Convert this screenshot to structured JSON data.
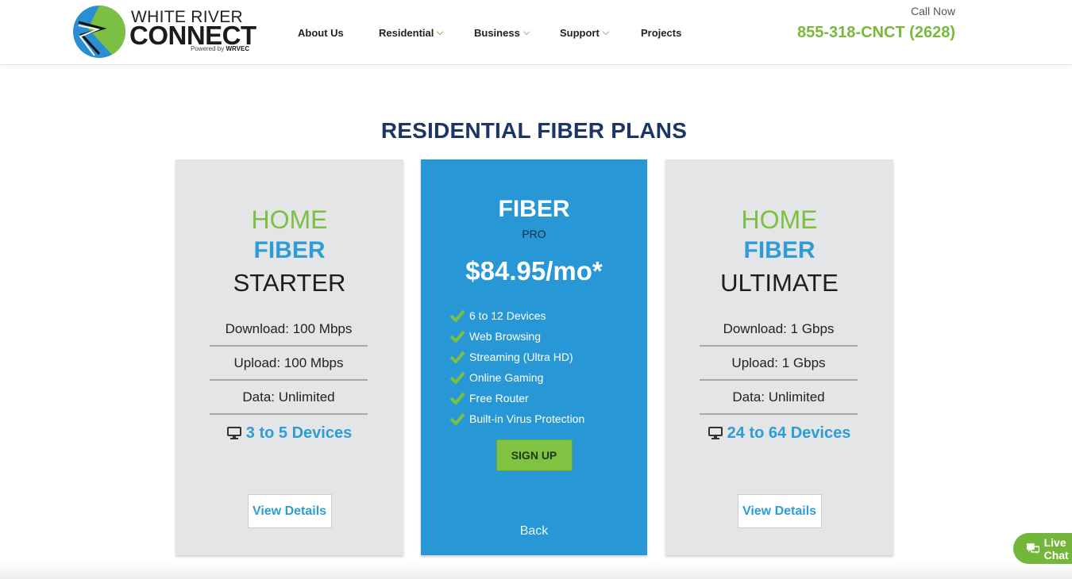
{
  "header": {
    "logo": {
      "top_text": "WHITE RIVER",
      "main_text": "CONNECT",
      "powered_by": "Powered by",
      "powered_brand": "WRVEC"
    },
    "nav": [
      {
        "label": "About Us",
        "dropdown": false
      },
      {
        "label": "Residential",
        "dropdown": true,
        "active": true
      },
      {
        "label": "Business",
        "dropdown": true
      },
      {
        "label": "Support",
        "dropdown": true
      },
      {
        "label": "Projects",
        "dropdown": false
      }
    ],
    "call_label": "Call Now",
    "phone": "855-318-CNCT (2628)"
  },
  "section_title": "RESIDENTIAL FIBER PLANS",
  "plans": [
    {
      "line1": "HOME",
      "line2": "FIBER",
      "line3": "STARTER",
      "download": "Download: 100 Mbps",
      "upload": "Upload: 100 Mbps",
      "data": "Data: Unlimited",
      "devices": "3 to 5 Devices",
      "button": "View Details"
    },
    {
      "title": "FIBER",
      "subtitle": "PRO",
      "price": "$84.95/mo*",
      "features": [
        "6 to 12 Devices",
        "Web Browsing",
        "Streaming (Ultra HD)",
        "Online Gaming",
        "Free Router",
        "Built-in Virus Protection"
      ],
      "signup": "SIGN UP",
      "back": "Back"
    },
    {
      "line1": "HOME",
      "line2": "FIBER",
      "line3": "ULTIMATE",
      "download": "Download: 1 Gbps",
      "upload": "Upload: 1 Gbps",
      "data": "Data: Unlimited",
      "devices": "24 to 64 Devices",
      "button": "View Details"
    }
  ],
  "live_chat": "Live Chat",
  "colors": {
    "brand_green": "#7cc043",
    "brand_blue": "#2897d5",
    "title_navy": "#1c3567"
  }
}
